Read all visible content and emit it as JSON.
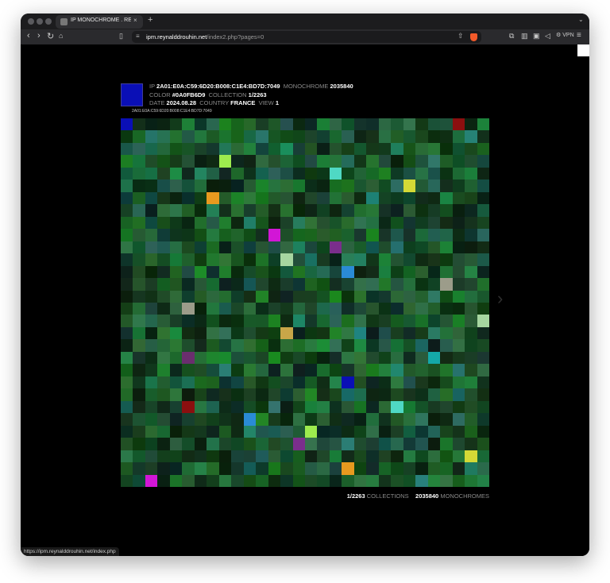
{
  "browser": {
    "tab_title": "IP MONOCHROME . REYNAL",
    "tab_close": "×",
    "new_tab": "+",
    "url_host": "ipm.reynalddrouhin.net",
    "url_path": "/index2.php?pages=0",
    "vpn_label": "VPN",
    "status_url": "https://ipm.reynalddrouhin.net/index.php"
  },
  "monochrome": {
    "swatch_color": "#0A0FB6",
    "ip_label": "IP",
    "ip_value": "2A01:E0A:C59:6D20:B008:C1E4:BD7D:7049",
    "mono_label": "MONOCHROME",
    "mono_value": "2035840",
    "color_label": "COLOR",
    "color_value": "#0A0FB6D9",
    "collection_label": "COLLECTION",
    "collection_value": "1/2263",
    "date_label": "DATE",
    "date_value": "2024.08.28",
    "country_label": "COUNTRY",
    "country_value": "FRANCE",
    "view_label": "VIEW",
    "view_value": "1",
    "ip_small": "2A01:E0A:C59:6D20:B008:C1E4:BD7D:7049"
  },
  "footer": {
    "collections_value": "1/2263",
    "collections_label": "COLLECTIONS",
    "monochromes_value": "2035840",
    "monochromes_label": "MONOCHROMES"
  },
  "grid": {
    "columns": 30,
    "rows": 30,
    "highlight_colors": [
      "#0A0FB6",
      "#8B0F0F",
      "#4FD8C4",
      "#9DEB4E",
      "#D4D936",
      "#E89A1F",
      "#D216D6",
      "#7A2E8C",
      "#9C9C8A",
      "#2A8BD6",
      "#A6D6A0",
      "#C8A648",
      "#6A2E6E",
      "#14A8A8"
    ]
  }
}
